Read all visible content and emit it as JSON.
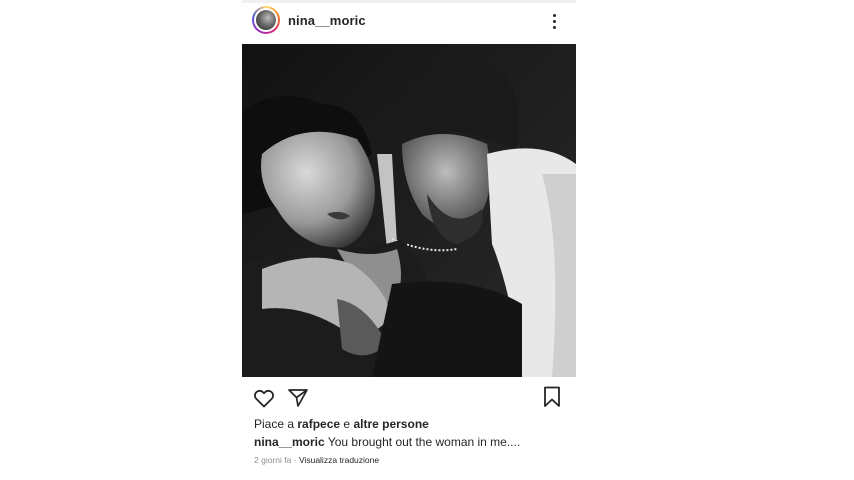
{
  "post": {
    "username": "nina__moric",
    "avatar_icon": "profile-avatar",
    "more_icon": "more-vertical-icon",
    "image_alt": "black and white photo of a couple",
    "actions": {
      "like_icon": "heart-icon",
      "share_icon": "send-icon",
      "save_icon": "bookmark-icon"
    },
    "likes": {
      "prefix": "Piace a",
      "user": "rafpece",
      "joiner": "e",
      "others": "altre persone"
    },
    "caption": {
      "user": "nina__moric",
      "text": "You brought out the woman in me...."
    },
    "meta": {
      "time": "2 giorni fa",
      "separator": "·",
      "translate_label": "Visualizza traduzione"
    }
  },
  "colors": {
    "text": "#262626",
    "muted": "#8e8e8e",
    "background": "#ffffff"
  }
}
